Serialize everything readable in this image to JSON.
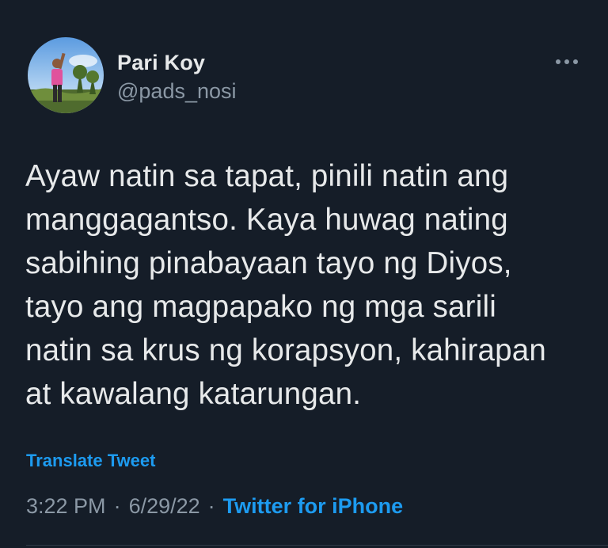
{
  "author": {
    "display_name": "Pari Koy",
    "handle": "@pads_nosi",
    "avatar_icon": "profile-photo"
  },
  "header": {
    "more_icon": "more-horizontal-icon"
  },
  "tweet": {
    "text": "Ayaw natin sa tapat, pinili natin ang\nmanggagantso. Kaya huwag nating\nsabihing pinabayaan tayo ng Diyos,\ntayo ang magpapako ng mga sarili\nnatin sa krus ng korapsyon, kahirapan\nat kawalang katarungan.",
    "translate_label": "Translate Tweet",
    "time": "3:22 PM",
    "date": "6/29/22",
    "separator": "·",
    "source": "Twitter for iPhone"
  },
  "colors": {
    "background": "#151d28",
    "primary_text": "#e7e9ea",
    "secondary_text": "#8b98a5",
    "accent": "#1d9bf0"
  }
}
